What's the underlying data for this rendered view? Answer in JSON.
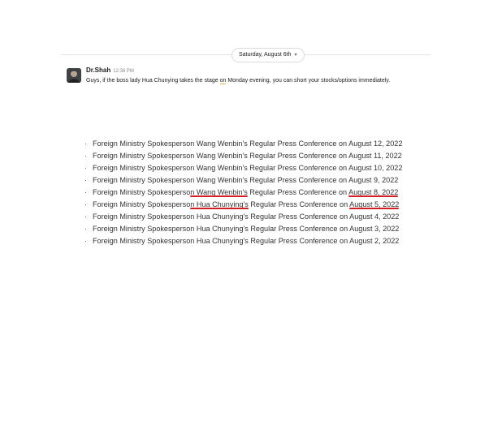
{
  "day_divider": {
    "label": "Saturday, August 6th",
    "chevron": "chevron-down-icon"
  },
  "message": {
    "author": "Dr.Shah",
    "time": "12:38 PM",
    "text_before": "Guys, if the boss lady Hua Chunying takes the stage ",
    "text_on": "on",
    "text_after": " Monday evening, you can short your stocks/options immediately."
  },
  "press_list": {
    "bullet": "·",
    "items": [
      {
        "prefix": "Foreign Ministry Spokesperso",
        "mid1": "n Wang Wenbin's",
        "mid2": " Regular Press Conference on ",
        "date": "August 12, 2022"
      },
      {
        "prefix": "Foreign Ministry Spokesperso",
        "mid1": "n Wang Wenbin's",
        "mid2": " Regular Press Conference on ",
        "date": "August 11, 2022"
      },
      {
        "prefix": "Foreign Ministry Spokesperso",
        "mid1": "n Wang Wenbin's",
        "mid2": " Regular Press Conference on ",
        "date": "August 10, 2022"
      },
      {
        "prefix": "Foreign Ministry Spokesperso",
        "mid1": "n Wang Wenbin's",
        "mid2": " Regular Press Conference on ",
        "date": "August 9, 2022"
      },
      {
        "prefix": "Foreign Ministry Spokesperso",
        "mid1": "n Wang Wenbin's",
        "mid2": " Regular Press Conference on ",
        "date": "August 8, 2022"
      },
      {
        "prefix": "Foreign Ministry Spokesperso",
        "mid1": "n Hua Chunying's",
        "mid2": " Regular Press Conference on ",
        "date": "August 5, 2022"
      },
      {
        "prefix": "Foreign Ministry Spokesperso",
        "mid1": "n Hua Chunying's",
        "mid2": " Regular Press Conference on ",
        "date": "August 4, 2022"
      },
      {
        "prefix": "Foreign Ministry Spokesperso",
        "mid1": "n Hua Chunying's",
        "mid2": " Regular Press Conference on ",
        "date": "August 3, 2022"
      },
      {
        "prefix": "Foreign Ministry Spokesperso",
        "mid1": "n Hua Chunying's",
        "mid2": " Regular Press Conference on ",
        "date": "August 2, 2022"
      }
    ],
    "underlined_items": [
      4,
      5
    ],
    "underline_color": "#d21f26"
  }
}
